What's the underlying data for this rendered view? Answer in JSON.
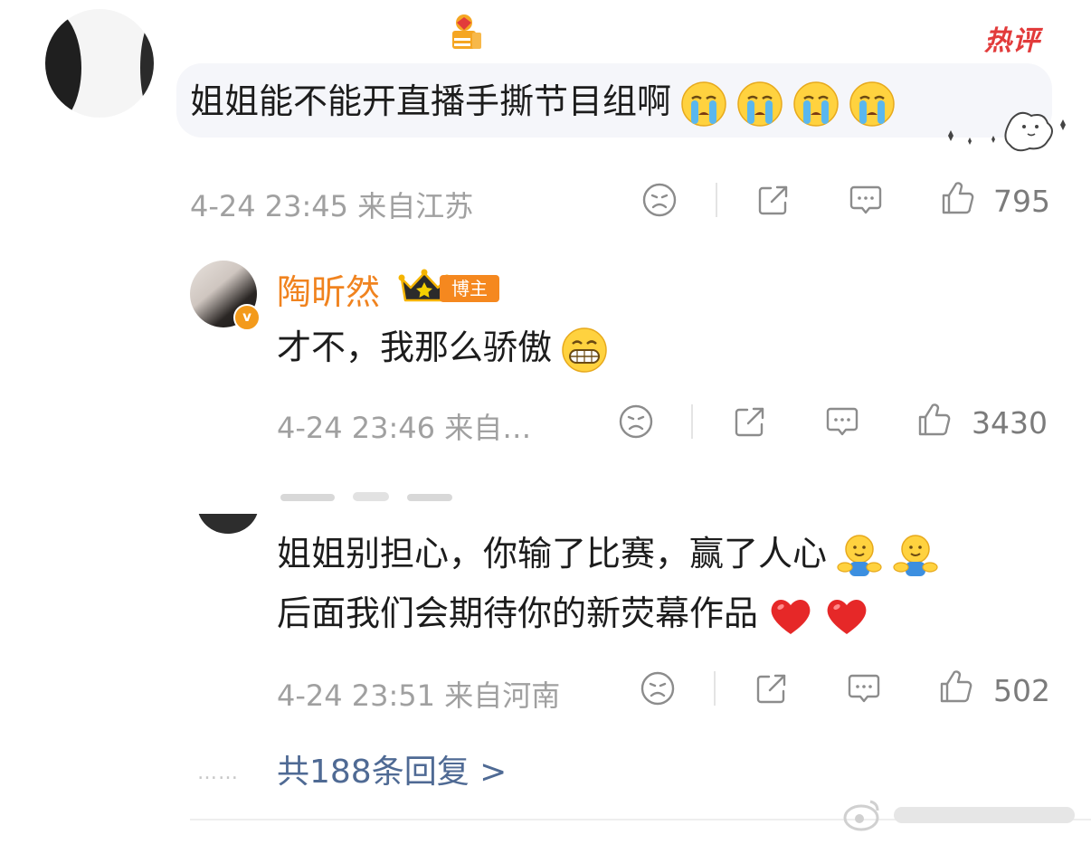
{
  "top_comment": {
    "hot_tag": "热评",
    "text": "姐姐能不能开直播手撕节目组啊",
    "emojis": [
      "crying-emoji",
      "crying-emoji",
      "crying-emoji",
      "crying-emoji"
    ],
    "time": "4-24 23:45",
    "location": "来自江苏",
    "likes": "795"
  },
  "replies": [
    {
      "username": "陶昕然",
      "tag": "博主",
      "verified_badge": "v",
      "text": "才不，我那么骄傲",
      "emojis": [
        "grin-emoji"
      ],
      "time": "4-24 23:46",
      "location": "来自…",
      "likes": "3430"
    },
    {
      "text_line1": "姐姐别担心，你输了比赛，赢了人心",
      "text_line2": "后面我们会期待你的新荧幕作品",
      "emojis_line1": [
        "hug-emoji",
        "hug-emoji"
      ],
      "emojis_line2": [
        "heart-emoji",
        "heart-emoji"
      ],
      "time": "4-24 23:51",
      "location": "来自河南",
      "likes": "502"
    }
  ],
  "more_replies": {
    "dots": "……",
    "label": "共188条回复 >"
  },
  "colors": {
    "username": "#f0831f",
    "hot_tag": "#e23b3b",
    "link": "#4f6a94",
    "meta": "#a0a0a0"
  }
}
